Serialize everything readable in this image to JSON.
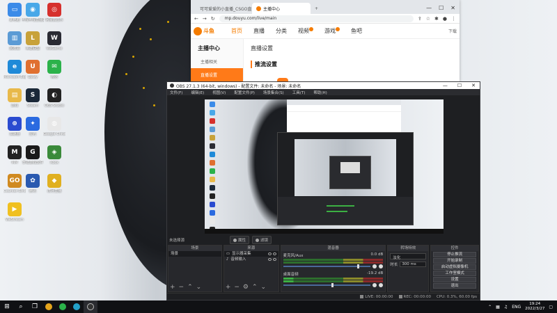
{
  "desktop": {
    "icons": [
      {
        "label": "此电脑",
        "color": "#3b8be8",
        "glyph": "▭"
      },
      {
        "label": "哔哩哔哩直播姬",
        "color": "#49a8e8",
        "glyph": "◉"
      },
      {
        "label": "网易云音乐",
        "color": "#d6302c",
        "glyph": "◎"
      },
      {
        "label": "回收站",
        "color": "#5b9bd5",
        "glyph": "▥"
      },
      {
        "label": "英雄联盟",
        "color": "#c8a23a",
        "glyph": "L"
      },
      {
        "label": "WeGame",
        "color": "#2a2b33",
        "glyph": "W"
      },
      {
        "label": "Microsoft Edge",
        "color": "#1f8ad8",
        "glyph": "e"
      },
      {
        "label": "Uplay",
        "color": "#e07030",
        "glyph": "U"
      },
      {
        "label": "微信",
        "color": "#2bb24a",
        "glyph": "✉"
      },
      {
        "label": "游戏",
        "color": "#e8b94a",
        "glyph": "▤"
      },
      {
        "label": "Steam",
        "color": "#1b2838",
        "glyph": "S"
      },
      {
        "label": "OBS Studio",
        "color": "#222",
        "glyph": "◐"
      },
      {
        "label": "加速器",
        "color": "#2a4bd0",
        "glyph": "⊕"
      },
      {
        "label": "星光",
        "color": "#2a6ae0",
        "glyph": "✦"
      },
      {
        "label": "Google Chrome",
        "color": "#e8e8e8",
        "glyph": "◍"
      },
      {
        "label": "MM",
        "color": "#222",
        "glyph": "M"
      },
      {
        "label": "罗技游戏软件",
        "color": "#1a1a1a",
        "glyph": "G"
      },
      {
        "label": "Xbox",
        "color": "#3a8a3a",
        "glyph": "◈"
      },
      {
        "label": "Counter-Strike Global Offensive",
        "color": "#d08a20",
        "glyph": "GO"
      },
      {
        "label": "腾讯",
        "color": "#2a5ab0",
        "glyph": "✿"
      },
      {
        "label": "虎牙直播",
        "color": "#e0b020",
        "glyph": "◆"
      },
      {
        "label": "WeStream",
        "color": "#f0c020",
        "glyph": "▶"
      }
    ]
  },
  "browser": {
    "tabs": [
      {
        "label": "可可爱爱的小直播_CSGO直播"
      },
      {
        "label": "主播中心"
      }
    ],
    "new_tab": "+",
    "win_controls": [
      "—",
      "☐",
      "✕"
    ],
    "url": "mp.douyu.com/live/main",
    "logo_text": "斗鱼",
    "nav": [
      "首页",
      "直播",
      "分类",
      "视频",
      "游戏",
      "鱼吧"
    ],
    "download_label": "下载",
    "sidebar_title": "主播中心",
    "sidebar_items": [
      "主播相关",
      "直播设置"
    ],
    "main_heading": "直播设置",
    "section_heading": "推流设置"
  },
  "obs": {
    "title": "OBS 27.1.3 (64-bit, windows) - 配置文件: 未命名 - 场景: 未命名",
    "menu": [
      "文件(F)",
      "编辑(E)",
      "视图(V)",
      "配置文件(P)",
      "场景集合(S)",
      "工具(T)",
      "帮助(H)"
    ],
    "no_source": "未选择源",
    "props_btn": "属性",
    "filter_btn": "滤镜",
    "dock_scenes": "场景",
    "dock_sources": "来源",
    "dock_mixer": "混音器",
    "dock_transitions": "转场特效",
    "dock_controls": "控件",
    "scene_item": "场景",
    "sources": [
      "显示器采集",
      "音频输入"
    ],
    "mixer": [
      {
        "name": "麦克风/Aux",
        "db": "0.0 dB",
        "knob": 0.85
      },
      {
        "name": "桌面音频",
        "db": "-19.2 dB",
        "knob": 0.55
      }
    ],
    "transition": "淡化",
    "duration_label": "时长",
    "duration_value": "300 ms",
    "controls": [
      "停止推流",
      "开始录制",
      "启动虚拟摄像机",
      "工作室模式",
      "设置",
      "退出"
    ],
    "status": {
      "live": "LIVE: 00:00:00",
      "rec": "REC: 00:00:00",
      "cpu": "CPU: 0.3%, 60.00 fps"
    }
  },
  "taskbar": {
    "ime": "ENG",
    "time": "19:24",
    "date": "2022/3/27"
  }
}
